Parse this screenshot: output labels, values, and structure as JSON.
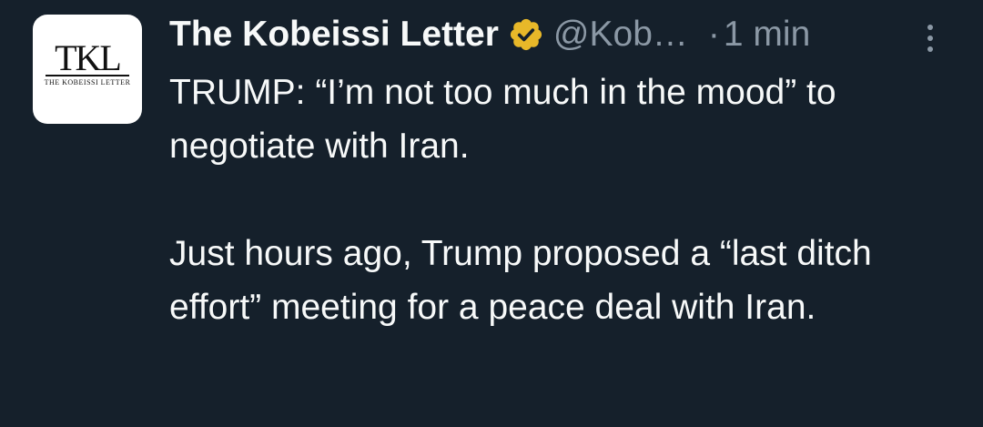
{
  "tweet": {
    "avatar": {
      "icon": "kobeissi-letter-logo",
      "mark": "TKL",
      "subtitle": "THE KOBEISSI LETTER"
    },
    "display_name": "The Kobeissi Letter",
    "verified_badge": {
      "icon": "verified-badge-icon",
      "color": "#e8b829"
    },
    "handle": "@Kob…",
    "separator": "·",
    "time": "1 min",
    "more_icon": "more-options-icon",
    "body": {
      "paragraph_1": "TRUMP: “I’m not too much in the mood” to negotiate with Iran.",
      "paragraph_2": "Just hours ago, Trump proposed a “last ditch effort” meeting for a peace deal with Iran."
    }
  },
  "colors": {
    "background": "#15202b",
    "primary_text": "#f7f9f9",
    "secondary_text": "#8b98a5"
  }
}
